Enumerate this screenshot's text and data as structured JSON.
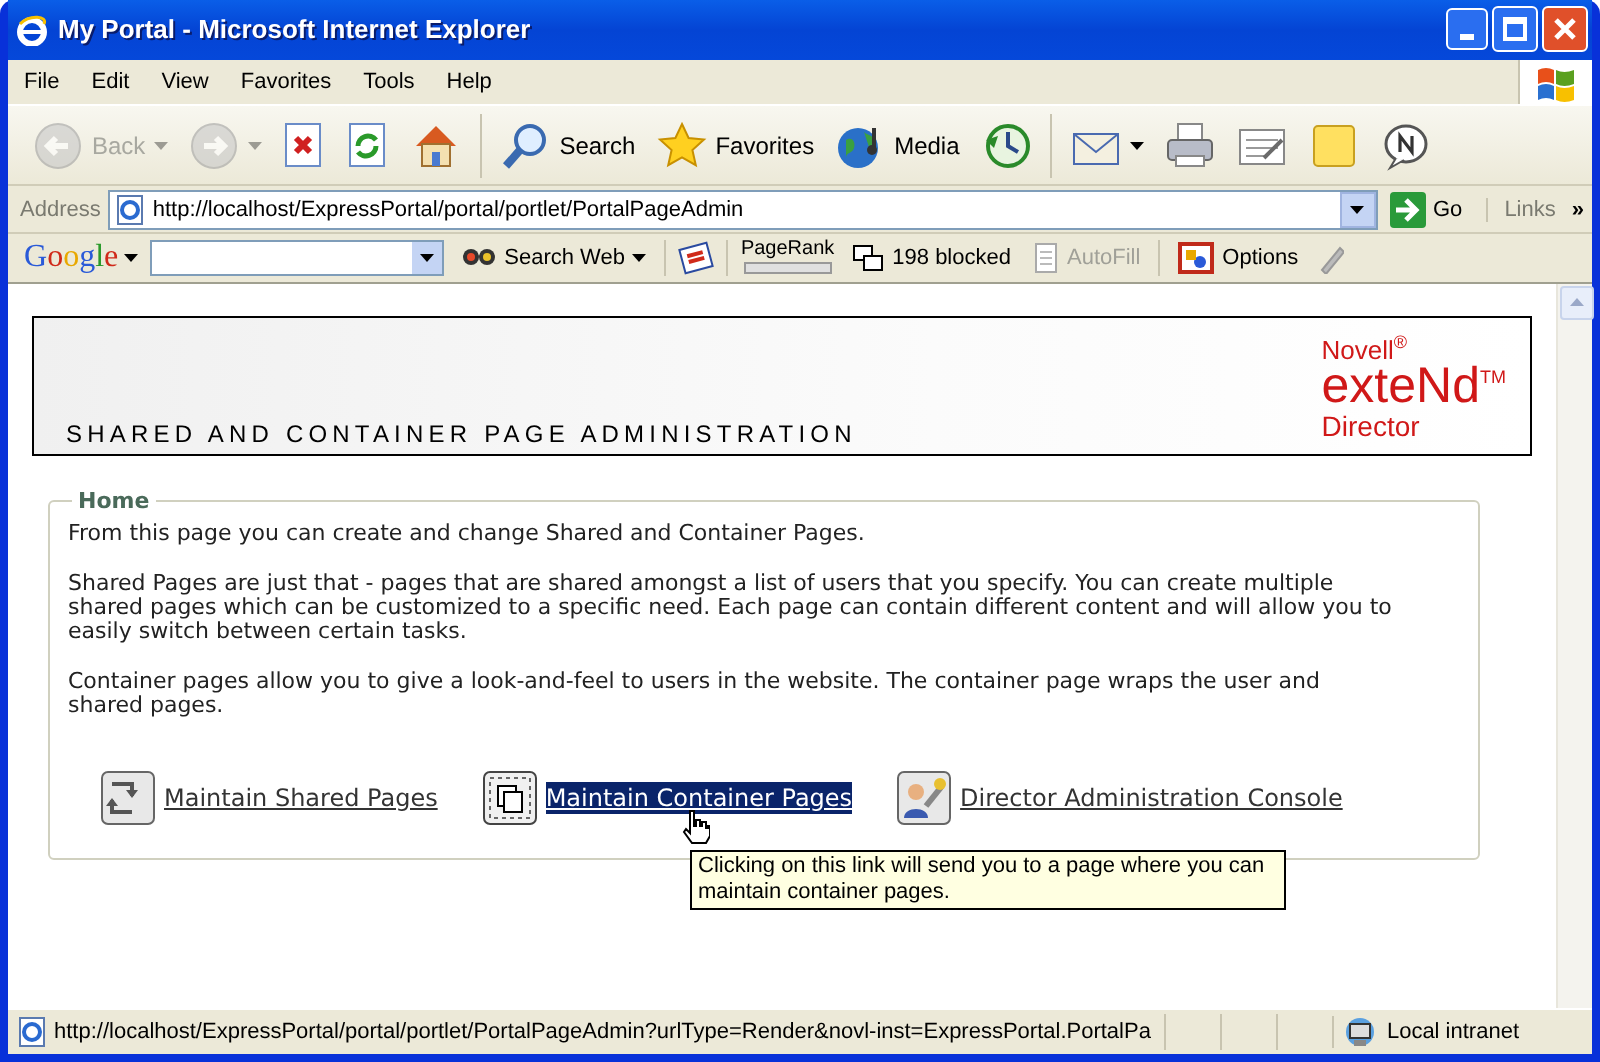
{
  "window": {
    "title": "My Portal - Microsoft Internet Explorer"
  },
  "menu": [
    "File",
    "Edit",
    "View",
    "Favorites",
    "Tools",
    "Help"
  ],
  "toolbar": [
    {
      "kind": "back",
      "label": "Back",
      "disabled": true,
      "dropdown": true
    },
    {
      "kind": "forward",
      "disabled": true,
      "dropdown": true
    },
    {
      "kind": "stop",
      "disabled": false,
      "dropdown": false
    },
    {
      "kind": "refresh",
      "disabled": false,
      "dropdown": false
    },
    {
      "kind": "home",
      "disabled": false,
      "dropdown": false
    },
    {
      "kind": "search",
      "label": "Search",
      "disabled": false,
      "dropdown": false
    },
    {
      "kind": "favorites",
      "label": "Favorites",
      "disabled": false,
      "dropdown": false
    },
    {
      "kind": "media",
      "label": "Media",
      "disabled": false,
      "dropdown": false
    },
    {
      "kind": "history",
      "disabled": false,
      "dropdown": false
    },
    {
      "kind": "mail",
      "disabled": false,
      "dropdown": true
    },
    {
      "kind": "print",
      "disabled": false,
      "dropdown": false
    },
    {
      "kind": "edit",
      "disabled": false,
      "dropdown": false
    },
    {
      "kind": "note",
      "disabled": false,
      "dropdown": false
    },
    {
      "kind": "messenger",
      "disabled": false,
      "dropdown": false
    }
  ],
  "address": {
    "label": "Address",
    "url": "http://localhost/ExpressPortal/portal/portlet/PortalPageAdmin",
    "go": "Go",
    "links": "Links",
    "more": "»"
  },
  "google_bar": {
    "logo": "Google",
    "search_web": "Search Web",
    "pagerank": "PageRank",
    "blocked": "198 blocked",
    "autofill": "AutoFill",
    "autofill_disabled": true,
    "options": "Options"
  },
  "page": {
    "logo": [
      "Novell$^{®}$",
      "exteNd$^{TM}$",
      "Director"
    ],
    "header": "SHARED AND CONTAINER PAGE ADMINISTRATION",
    "legend": "Home",
    "paragraphs": [
      "From this page you can create and change Shared and Container Pages.",
      "Shared Pages are just that - pages that are shared amongst a list of users that you specify. You can create multiple shared pages which can be customized to a specific need. Each page can contain different content and will allow you to easily switch between certain tasks.",
      "Container pages allow you to give a look-and-feel to users in the website. The container page wraps the user and shared pages."
    ],
    "links": [
      {
        "kind": "shared",
        "label": "Maintain Shared Pages",
        "selected": false
      },
      {
        "kind": "container",
        "label": "Maintain Container Pages",
        "selected": true
      },
      {
        "kind": "console",
        "label": "Director Administration Console",
        "selected": false
      }
    ],
    "tooltip": "Clicking on this link will send you to a page where you can maintain container pages."
  },
  "status_bar": {
    "url": "http://localhost/ExpressPortal/portal/portlet/PortalPageAdmin?urlType=Render&novl-inst=ExpressPortal.PortalPa",
    "zone": "Local intranet"
  }
}
